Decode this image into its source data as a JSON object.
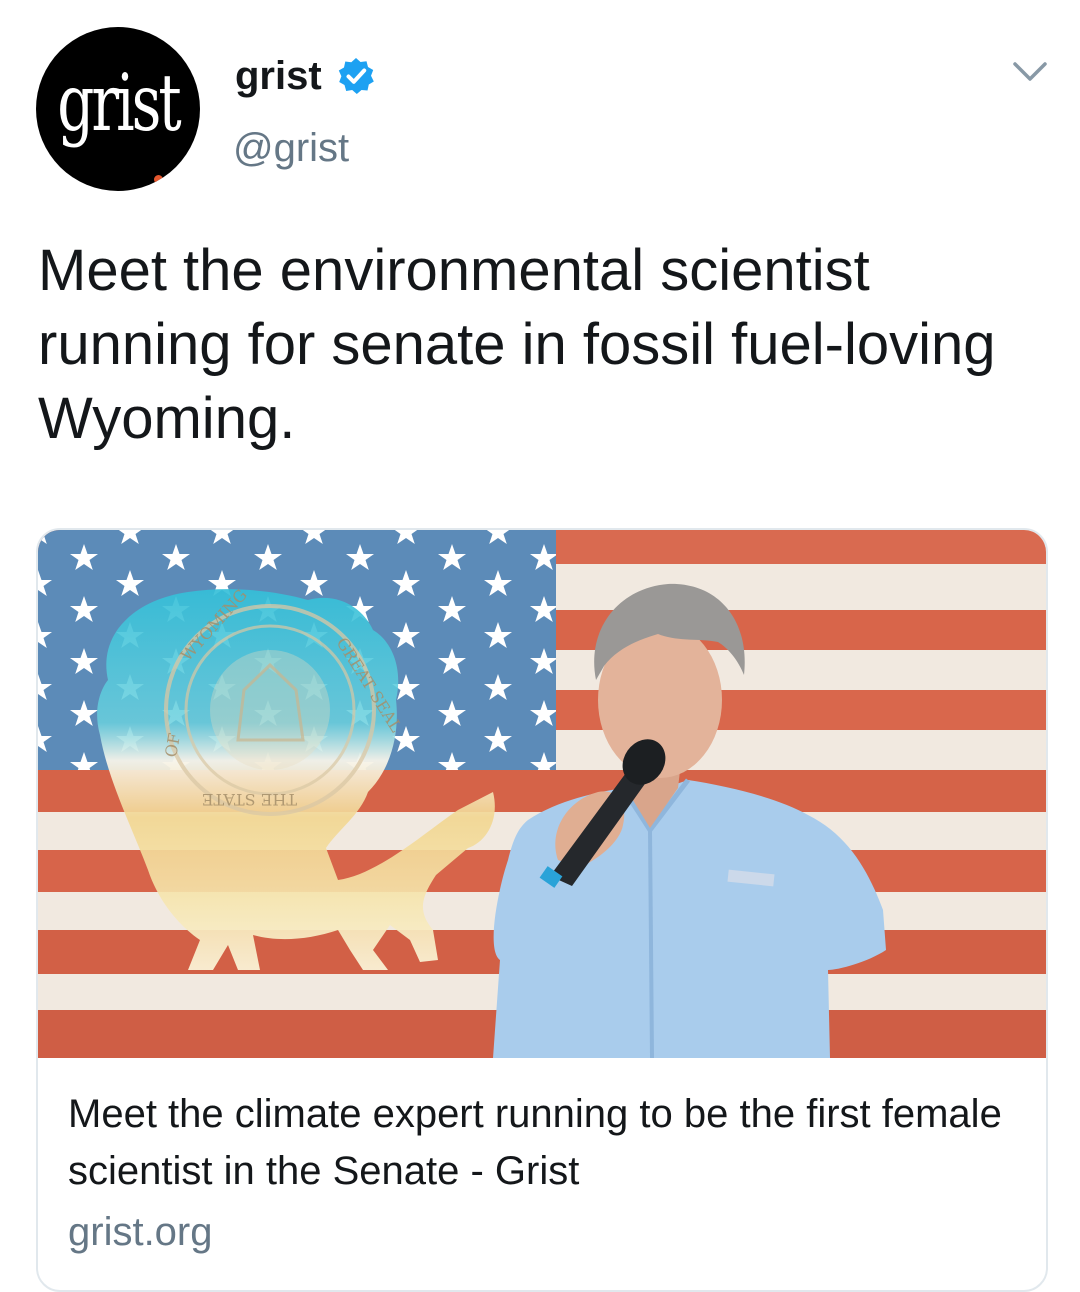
{
  "tweet": {
    "avatar_text": "grist",
    "display_name": "grist",
    "verified": true,
    "handle": "@grist",
    "menu_icon": "chevron-down-icon",
    "text": "Meet the environmental scientist running for senate in fossil fuel-loving Wyoming."
  },
  "card": {
    "image": {
      "seal_text_top": "WYOMING",
      "seal_text_left": "OF",
      "seal_text_bottom": "THE STATE",
      "seal_text_right": "GREAT SEAL"
    },
    "title": "Meet the climate expert running to be the first female scientist in the Senate - Grist",
    "domain": "grist.org"
  },
  "colors": {
    "verified_blue": "#1da1f2",
    "handle_gray": "#657786",
    "flag_red": "#d9644a",
    "flag_blue": "#5b8ab8",
    "bison_teal": "#43c4d6"
  }
}
